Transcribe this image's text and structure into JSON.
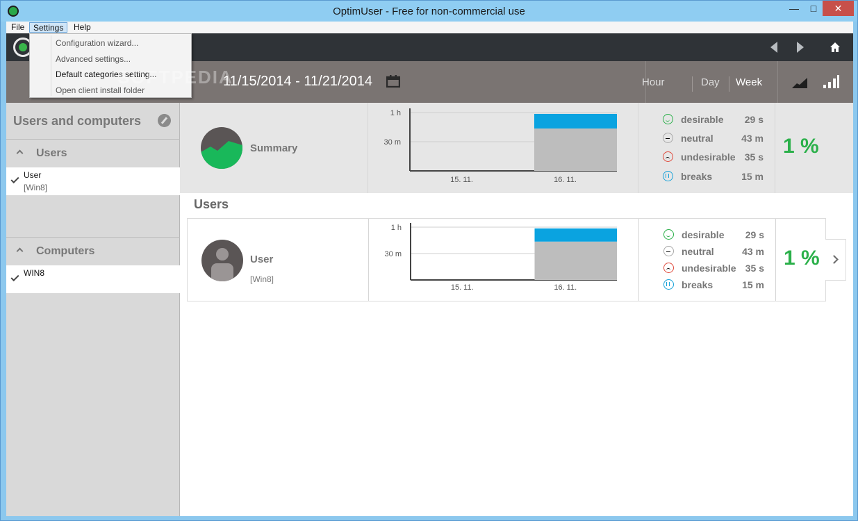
{
  "window": {
    "title": "OptimUser - Free for non-commercial use",
    "minimize": "—",
    "maximize": "□",
    "close": "✕"
  },
  "menu": {
    "file": "File",
    "settings": "Settings",
    "help": "Help"
  },
  "dropdown": {
    "items": [
      "Configuration wizard...",
      "Advanced settings...",
      "Default categories setting...",
      "Open client install folder"
    ]
  },
  "watermark": "SOFTPEDIA",
  "header": {
    "date_range": "11/15/2014 - 11/21/2014",
    "periods": [
      "Hour",
      "Day",
      "Week"
    ],
    "active_period": "Week"
  },
  "sidebar": {
    "title": "Users and computers",
    "users_section": "Users",
    "users": [
      {
        "name": "User",
        "sub": "[Win8]"
      }
    ],
    "computers_section": "Computers",
    "computers": [
      {
        "name": "WIN8"
      }
    ]
  },
  "summary": {
    "name": "Summary",
    "percent": "1 %",
    "legend": [
      {
        "label": "desirable",
        "value": "29 s",
        "color": "#2bb04a"
      },
      {
        "label": "neutral",
        "value": "43 m",
        "color": "#a8a8a8"
      },
      {
        "label": "undesirable",
        "value": "35 s",
        "color": "#e04a3c"
      },
      {
        "label": "breaks",
        "value": "15 m",
        "color": "#1aa3d9"
      }
    ]
  },
  "users_section_title": "Users",
  "user_row": {
    "name": "User",
    "sub": "[Win8]",
    "percent": "1 %",
    "legend": [
      {
        "label": "desirable",
        "value": "29 s",
        "color": "#2bb04a"
      },
      {
        "label": "neutral",
        "value": "43 m",
        "color": "#a8a8a8"
      },
      {
        "label": "undesirable",
        "value": "35 s",
        "color": "#e04a3c"
      },
      {
        "label": "breaks",
        "value": "15 m",
        "color": "#1aa3d9"
      }
    ]
  },
  "chart_data": [
    {
      "type": "bar",
      "categories": [
        "15. 11.",
        "16. 11."
      ],
      "yticks": [
        "1 h",
        "30 m"
      ],
      "ylim": [
        0,
        60
      ],
      "series": [
        {
          "values": [
            0,
            43.6
          ],
          "color": "#bdbdbd"
        },
        {
          "values": [
            0,
            15
          ],
          "color": "#0aa3e0"
        }
      ]
    },
    {
      "type": "bar",
      "categories": [
        "15. 11.",
        "16. 11."
      ],
      "yticks": [
        "1 h",
        "30 m"
      ],
      "ylim": [
        0,
        60
      ],
      "series": [
        {
          "values": [
            0,
            43.6
          ],
          "color": "#bdbdbd"
        },
        {
          "values": [
            0,
            15
          ],
          "color": "#0aa3e0"
        }
      ]
    }
  ]
}
